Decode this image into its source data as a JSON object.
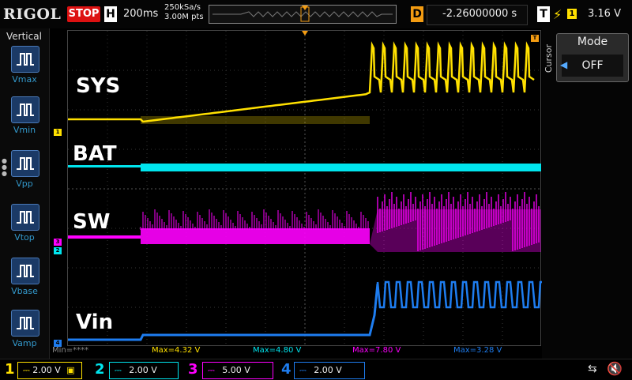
{
  "header": {
    "brand": "RIGOL",
    "run_state": "STOP",
    "timebase_label": "H",
    "timebase_value": "200ms",
    "sample_rate": "250kSa/s",
    "memory_depth": "3.00M pts",
    "delay_label": "D",
    "delay_value": "-2.26000000 s",
    "trigger_label": "T",
    "trigger_channel": "1",
    "trigger_level": "3.16 V"
  },
  "vertical_menu": {
    "title": "Vertical",
    "items": [
      "Vmax",
      "Vmin",
      "Vpp",
      "Vtop",
      "Vbase",
      "Vamp"
    ]
  },
  "cursor_panel": {
    "side_label": "Cursor",
    "mode_title": "Mode",
    "mode_value": "OFF"
  },
  "traces": {
    "sys_label": "SYS",
    "bat_label": "BAT",
    "sw_label": "SW",
    "vin_label": "Vin"
  },
  "measurements": {
    "min": "Min=****",
    "max1": "Max=4.32 V",
    "max2": "Max=4.80 V",
    "max3": "Max=7.80 V",
    "max4": "Max=3.28 V"
  },
  "channels": [
    {
      "num": "1",
      "scale": "2.00 V",
      "color": "#ffe000"
    },
    {
      "num": "2",
      "scale": "2.00 V",
      "color": "#00e5ee"
    },
    {
      "num": "3",
      "scale": "5.00 V",
      "color": "#ff00ff"
    },
    {
      "num": "4",
      "scale": "2.00 V",
      "color": "#1e7df0"
    }
  ],
  "icons": {
    "usb": "usb-icon",
    "mute": "speaker-mute-icon"
  }
}
